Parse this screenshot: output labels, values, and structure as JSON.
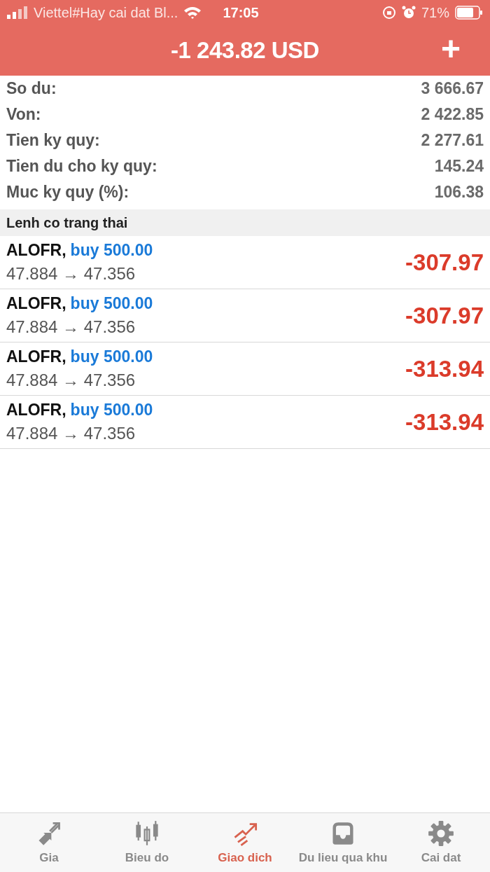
{
  "status_bar": {
    "carrier": "Viettel#Hay cai dat Bl...",
    "time": "17:05",
    "battery": "71%"
  },
  "header": {
    "title": "-1 243.82 USD",
    "add": "+"
  },
  "summary": [
    {
      "label": "So du:",
      "value": "3 666.67"
    },
    {
      "label": "Von:",
      "value": "2 422.85"
    },
    {
      "label": "Tien ky quy:",
      "value": "2 277.61"
    },
    {
      "label": "Tien du cho ky quy:",
      "value": "145.24"
    },
    {
      "label": "Muc ky quy (%):",
      "value": "106.38"
    }
  ],
  "section": {
    "title": "Lenh co trang thai"
  },
  "positions": [
    {
      "symbol": "ALOFR,",
      "order": "buy 500.00",
      "prices": "47.884 → 47.356",
      "profit": "-307.97"
    },
    {
      "symbol": "ALOFR,",
      "order": "buy 500.00",
      "prices": "47.884 → 47.356",
      "profit": "-307.97"
    },
    {
      "symbol": "ALOFR,",
      "order": "buy 500.00",
      "prices": "47.884 → 47.356",
      "profit": "-313.94"
    },
    {
      "symbol": "ALOFR,",
      "order": "buy 500.00",
      "prices": "47.884 → 47.356",
      "profit": "-313.94"
    }
  ],
  "tabs": [
    {
      "label": "Gia",
      "selected": false
    },
    {
      "label": "Bieu do",
      "selected": false
    },
    {
      "label": "Giao dich",
      "selected": true
    },
    {
      "label": "Du lieu qua khu",
      "selected": false
    },
    {
      "label": "Cai dat",
      "selected": false
    }
  ]
}
